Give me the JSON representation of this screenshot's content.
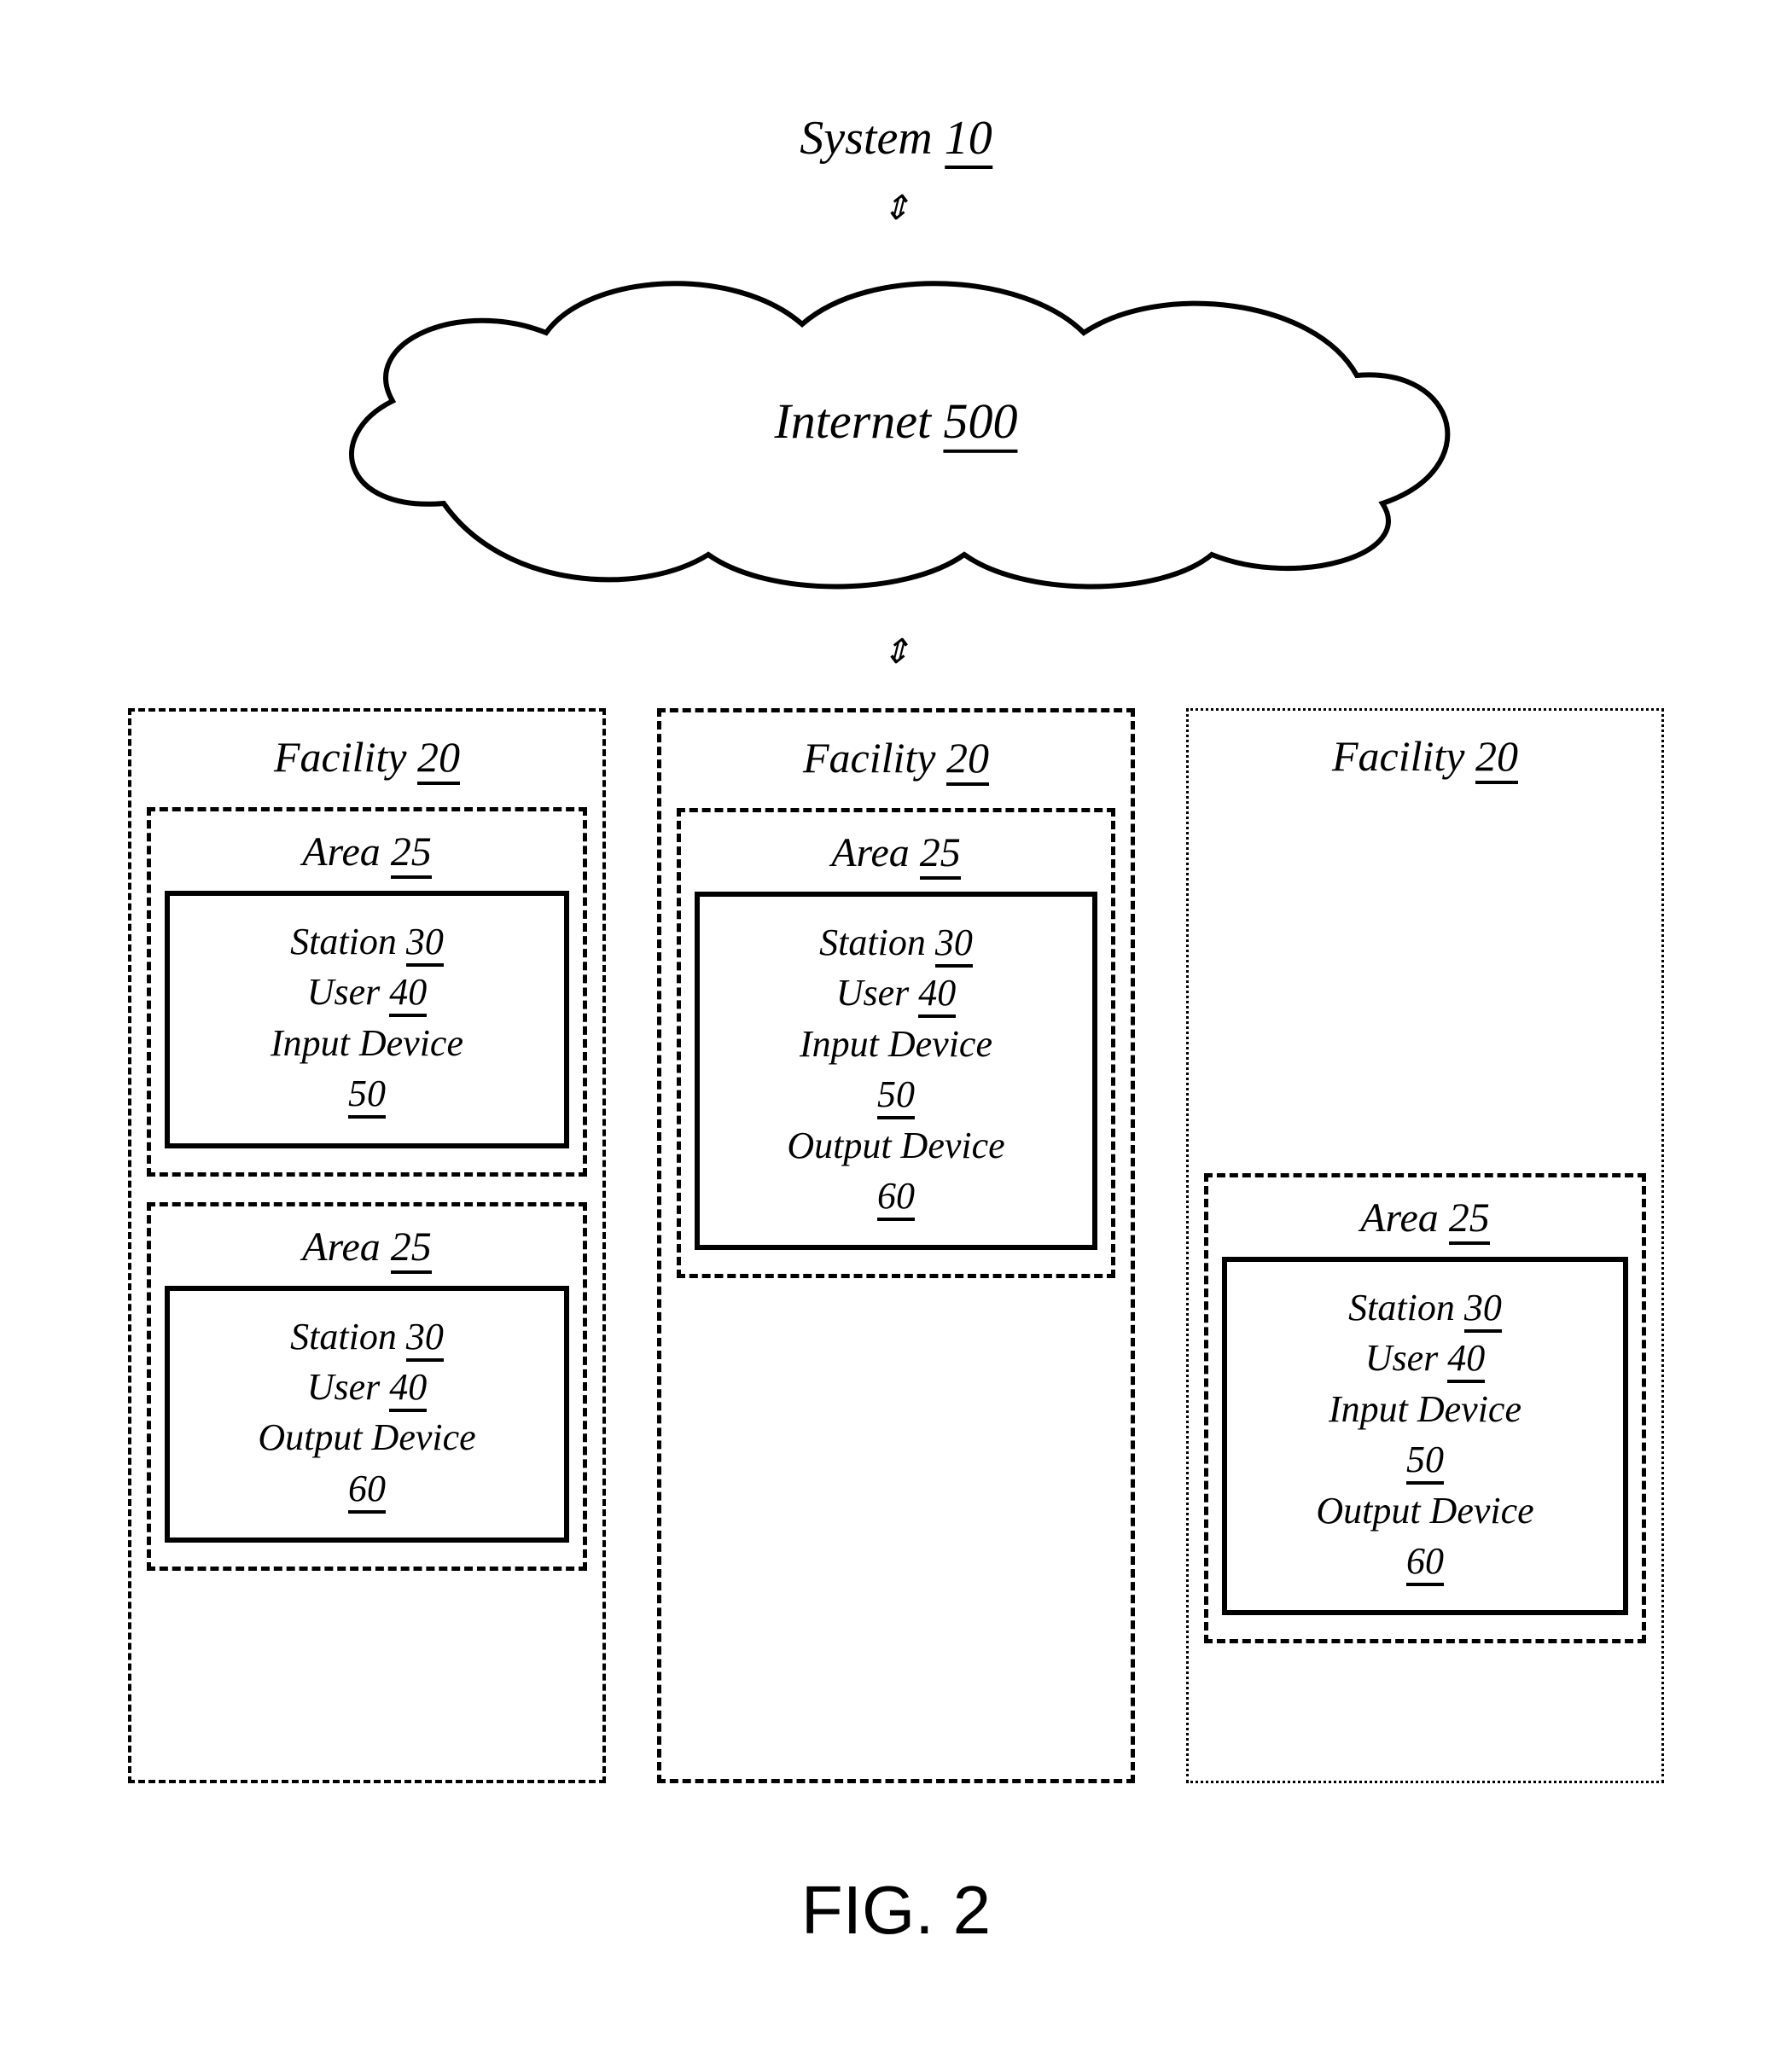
{
  "system": {
    "label": "System",
    "num": "10"
  },
  "internet": {
    "label": "Internet",
    "num": "500"
  },
  "facilities": [
    {
      "title": "Facility",
      "num": "20",
      "areas": [
        {
          "title": "Area",
          "num": "25",
          "lines": [
            {
              "t": "Station",
              "n": "30"
            },
            {
              "t": "User",
              "n": "40"
            },
            {
              "t": "Input Device",
              "n": "50"
            }
          ]
        },
        {
          "title": "Area",
          "num": "25",
          "lines": [
            {
              "t": "Station",
              "n": "30"
            },
            {
              "t": "User",
              "n": "40"
            },
            {
              "t": "Output Device",
              "n": "60"
            }
          ]
        }
      ]
    },
    {
      "title": "Facility",
      "num": "20",
      "areas": [
        {
          "title": "Area",
          "num": "25",
          "lines": [
            {
              "t": "Station",
              "n": "30"
            },
            {
              "t": "User",
              "n": "40"
            },
            {
              "t": "Input Device",
              "n": "50"
            },
            {
              "t": "Output Device",
              "n": "60"
            }
          ]
        }
      ]
    },
    {
      "title": "Facility",
      "num": "20",
      "areas": [
        {
          "title": "Area",
          "num": "25",
          "lines": [
            {
              "t": "Station",
              "n": "30"
            },
            {
              "t": "User",
              "n": "40"
            },
            {
              "t": "Input Device",
              "n": "50"
            },
            {
              "t": "Output Device",
              "n": "60"
            }
          ]
        }
      ],
      "bottom": true
    }
  ],
  "figure": "FIG. 2"
}
